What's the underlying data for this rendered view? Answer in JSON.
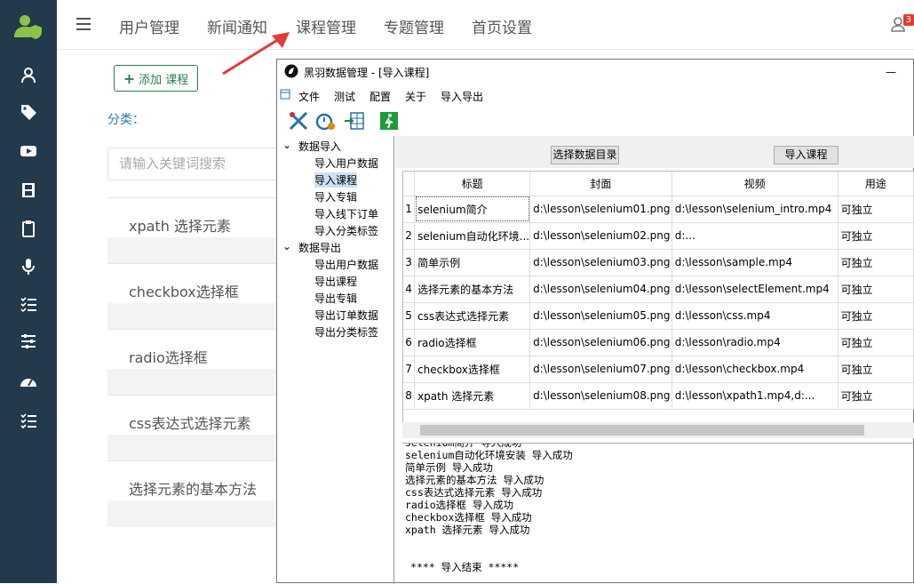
{
  "web": {
    "top_nav": [
      "用户管理",
      "新闻通知",
      "课程管理",
      "专题管理",
      "首页设置"
    ],
    "badge_count": "3",
    "add_button": "添加 课程",
    "category_label": "分类：",
    "search_placeholder": "请输入关键词搜索",
    "courses": [
      "xpath 选择元素",
      "checkbox选择框",
      "radio选择框",
      "css表达式选择元素",
      "选择元素的基本方法"
    ],
    "sidebar_icons": [
      "user-icon",
      "tags-icon",
      "youtube-icon",
      "film-icon",
      "clipboard-icon",
      "microphone-icon",
      "list-icon",
      "sliders-icon",
      "dashboard-icon",
      "list-icon"
    ]
  },
  "window": {
    "title": "黑羽数据管理 - [导入课程]",
    "minimize": "—",
    "menu": [
      "文件",
      "测试",
      "配置",
      "关于",
      "导入导出"
    ],
    "tree": {
      "import_group": "数据导入",
      "import_items": [
        "导入用户数据",
        "导入课程",
        "导入专辑",
        "导入线下订单",
        "导入分类标签"
      ],
      "export_group": "数据导出",
      "export_items": [
        "导出用户数据",
        "导出课程",
        "导出专辑",
        "导出订单数据",
        "导出分类标签"
      ],
      "selected": "导入课程"
    },
    "buttons": {
      "select_dir": "选择数据目录",
      "import": "导入课程"
    },
    "table": {
      "headers": [
        "标题",
        "封面",
        "视频",
        "用途"
      ],
      "rows": [
        [
          "1",
          "selenium简介",
          "d:\\lesson\\selenium01.png",
          "d:\\lesson\\selenium_intro.mp4",
          "可独立"
        ],
        [
          "2",
          "selenium自动化环境...",
          "d:\\lesson\\selenium02.png",
          "d:...",
          "可独立"
        ],
        [
          "3",
          "简单示例",
          "d:\\lesson\\selenium03.png",
          "d:\\lesson\\sample.mp4",
          "可独立"
        ],
        [
          "4",
          "选择元素的基本方法",
          "d:\\lesson\\selenium04.png",
          "d:\\lesson\\selectElement.mp4",
          "可独立"
        ],
        [
          "5",
          "css表达式选择元素",
          "d:\\lesson\\selenium05.png",
          "d:\\lesson\\css.mp4",
          "可独立"
        ],
        [
          "6",
          "radio选择框",
          "d:\\lesson\\selenium06.png",
          "d:\\lesson\\radio.mp4",
          "可独立"
        ],
        [
          "7",
          "checkbox选择框",
          "d:\\lesson\\selenium07.png",
          "d:\\lesson\\checkbox.mp4",
          "可独立"
        ],
        [
          "8",
          "xpath 选择元素",
          "d:\\lesson\\selenium08.png",
          "d:\\lesson\\xpath1.mp4,d:...",
          "可独立"
        ]
      ]
    },
    "log": [
      "selenium简介 导入成功",
      "selenium自动化环境安装 导入成功",
      "简单示例 导入成功",
      "选择元素的基本方法 导入成功",
      "css表达式选择元素 导入成功",
      "radio选择框 导入成功",
      "checkbox选择框 导入成功",
      "xpath 选择元素 导入成功",
      "",
      "",
      "**** 导入结束 *****"
    ]
  },
  "colors": {
    "sidebar": "#23394c",
    "accent_green": "#2e7d4f",
    "link_blue": "#2a7bbf",
    "arrow_red": "#e53935",
    "badge": "#e53935"
  }
}
